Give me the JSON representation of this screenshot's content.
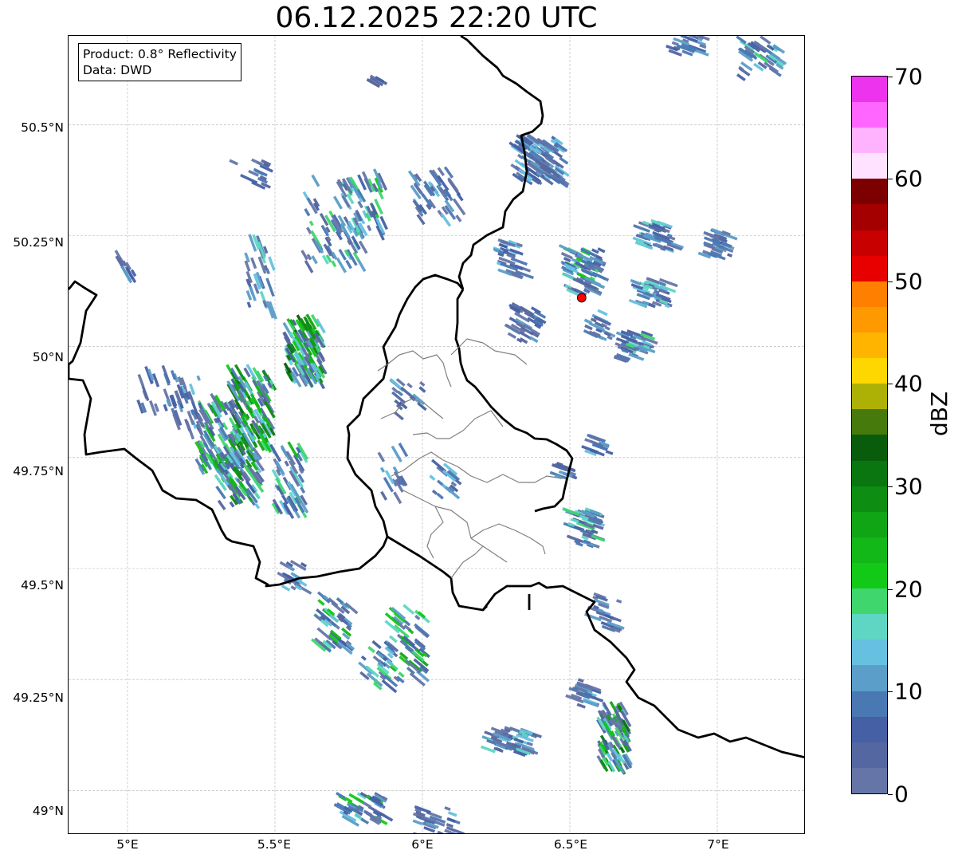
{
  "title": "06.12.2025 22:20 UTC",
  "info_box": {
    "product": "Product: 0.8° Reflectivity",
    "data": "Data: DWD"
  },
  "lat_ticks": [
    "50.5°N",
    "50.25°N",
    "50°N",
    "49.75°N",
    "49.5°N",
    "49.25°N",
    "49°N"
  ],
  "lon_ticks": [
    "5°E",
    "5.5°E",
    "6°E",
    "6.5°E",
    "7°E"
  ],
  "colorbar": {
    "label": "dBZ",
    "ticks": [
      "0",
      "10",
      "20",
      "30",
      "40",
      "50",
      "60",
      "70"
    ],
    "min": 0,
    "max": 70,
    "step": 2.5,
    "colors": [
      "#6575a8",
      "#5567a0",
      "#4560a4",
      "#4a78b3",
      "#5a9ec9",
      "#66c1e0",
      "#5fd6c4",
      "#3fd66e",
      "#12c918",
      "#12b818",
      "#10a515",
      "#0d8e12",
      "#0a760f",
      "#085c0b",
      "#467a0c",
      "#adb106",
      "#ffd700",
      "#ffb500",
      "#ff9900",
      "#ff7f00",
      "#e60000",
      "#c80000",
      "#a50000",
      "#7d0000",
      "#ffe2ff",
      "#ffb3ff",
      "#ff66ff",
      "#ee33ee"
    ]
  },
  "map": {
    "extent": {
      "lon_min": 4.8,
      "lon_max": 7.3,
      "lat_min": 48.9,
      "lat_max": 50.7
    },
    "marker": {
      "lon": 6.54,
      "lat": 50.11,
      "color": "#ff0000"
    }
  }
}
